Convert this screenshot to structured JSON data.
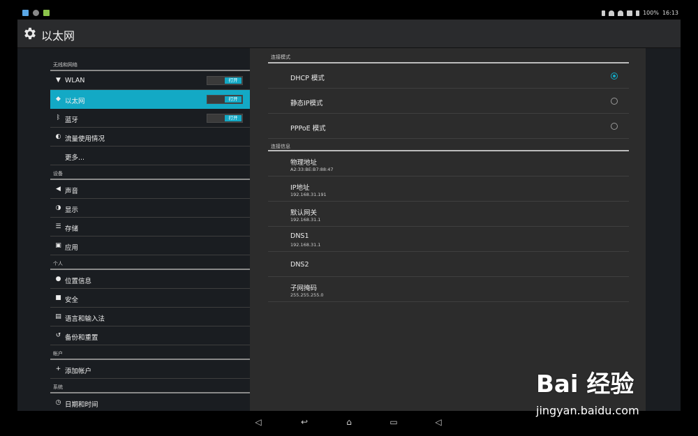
{
  "status_bar": {
    "battery": "100%",
    "time": "16:13",
    "icons": [
      "notification-app-icon",
      "notification-shield-icon",
      "notification-android-icon",
      "bluetooth-icon",
      "headset-icon",
      "wifi-icon",
      "ethernet-icon",
      "battery-icon"
    ]
  },
  "action_bar": {
    "title": "以太网",
    "icon": "gear-icon"
  },
  "sections": [
    {
      "header": "无线和网络",
      "items": [
        {
          "label": "WLAN",
          "icon": "wifi-icon",
          "toggle": "打开"
        },
        {
          "label": "以太网",
          "icon": "ethernet-icon",
          "toggle": "打开",
          "selected": true
        },
        {
          "label": "蓝牙",
          "icon": "bluetooth-icon",
          "toggle": "打开"
        },
        {
          "label": "流量使用情况",
          "icon": "data-usage-icon"
        },
        {
          "label": "更多...",
          "icon": ""
        }
      ]
    },
    {
      "header": "设备",
      "items": [
        {
          "label": "声音",
          "icon": "sound-icon"
        },
        {
          "label": "显示",
          "icon": "display-icon"
        },
        {
          "label": "存储",
          "icon": "storage-icon"
        },
        {
          "label": "应用",
          "icon": "apps-icon"
        }
      ]
    },
    {
      "header": "个人",
      "items": [
        {
          "label": "位置信息",
          "icon": "location-icon"
        },
        {
          "label": "安全",
          "icon": "lock-icon"
        },
        {
          "label": "语言和输入法",
          "icon": "language-icon"
        },
        {
          "label": "备份和重置",
          "icon": "backup-icon"
        }
      ]
    },
    {
      "header": "帐户",
      "items": [
        {
          "label": "添加帐户",
          "icon": "plus-icon"
        }
      ]
    },
    {
      "header": "系统",
      "items": [
        {
          "label": "日期和时间",
          "icon": "clock-icon"
        }
      ]
    }
  ],
  "detail": {
    "mode_header": "连接模式",
    "modes": [
      {
        "label": "DHCP 模式",
        "checked": true
      },
      {
        "label": "静态IP模式",
        "checked": false
      },
      {
        "label": "PPPoE 模式",
        "checked": false
      }
    ],
    "info_header": "连接信息",
    "info": [
      {
        "title": "物理地址",
        "value": "A2:33:BE:B7:88:47"
      },
      {
        "title": "IP地址",
        "value": "192.168.31.191"
      },
      {
        "title": "默认网关",
        "value": "192.168.31.1"
      },
      {
        "title": "DNS1",
        "value": "192.168.31.1"
      },
      {
        "title": "DNS2",
        "value": ""
      },
      {
        "title": "子网掩码",
        "value": "255.255.255.0"
      }
    ]
  },
  "nav_bar": [
    "volume-down-icon",
    "back-icon",
    "home-icon",
    "recents-icon",
    "volume-up-icon"
  ],
  "watermark": {
    "logo_text": "Bai 经验",
    "url": "jingyan.baidu.com"
  },
  "colors": {
    "accent": "#13a9c5",
    "panel": "#2c2c2c",
    "background": "#1a1d21"
  }
}
